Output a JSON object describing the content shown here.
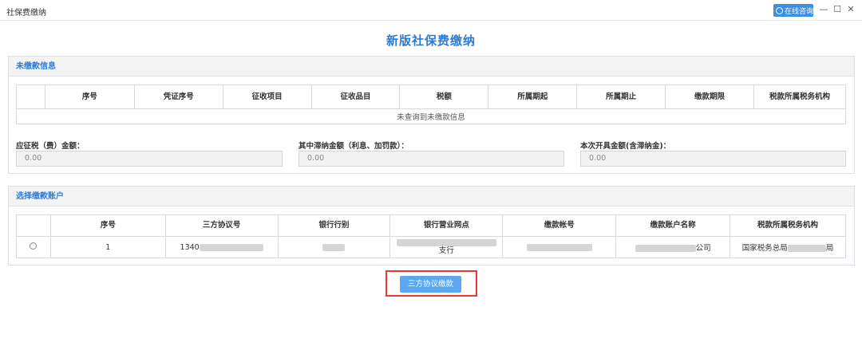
{
  "window": {
    "title": "社保费缴纳",
    "consult_label": "在线咨询",
    "minimize": "—",
    "maximize": "☐",
    "close": "✕"
  },
  "page_title": "新版社保费缴纳",
  "unpaid": {
    "heading": "未缴款信息",
    "columns": [
      "",
      "序号",
      "凭证序号",
      "征收项目",
      "征收品目",
      "税额",
      "所属期起",
      "所属期止",
      "缴款期限",
      "税款所属税务机构"
    ],
    "empty_text": "未查询到未缴款信息",
    "fields": [
      {
        "label": "应征税（费）金额：",
        "value": "0.00"
      },
      {
        "label": "其中滞纳金额（利息、加罚款）：",
        "value": "0.00"
      },
      {
        "label": "本次开具金额(含滞纳金)：",
        "value": "0.00"
      }
    ]
  },
  "account": {
    "heading": "选择缴款账户",
    "columns": [
      "",
      "序号",
      "三方协议号",
      "银行行别",
      "银行营业网点",
      "缴款帐号",
      "缴款账户名称",
      "税款所属税务机构"
    ],
    "rows": [
      {
        "index": "1",
        "agreement_no": "1340",
        "branch_suffix": "支行",
        "account_name_suffix": "公司",
        "tax_org_prefix": "国家税务总局",
        "tax_org_suffix": "局"
      }
    ]
  },
  "pay_button": "三方协议缴款",
  "colors": {
    "accent": "#2b7bd6",
    "button": "#5aa8f0",
    "highlight": "#e53935"
  }
}
